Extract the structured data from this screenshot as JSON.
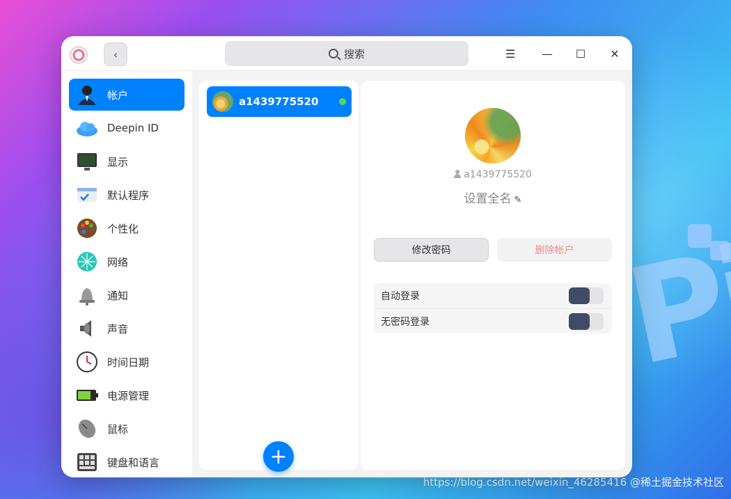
{
  "window": {
    "search_placeholder": "搜索",
    "back_label": "‹",
    "menu_label": "☰",
    "minimize_label": "—",
    "maximize_label": "☐",
    "close_label": "✕"
  },
  "sidebar": {
    "items": [
      {
        "label": "帐户",
        "icon": "account-icon",
        "active": true
      },
      {
        "label": "Deepin ID",
        "icon": "cloud-icon"
      },
      {
        "label": "显示",
        "icon": "display-icon"
      },
      {
        "label": "默认程序",
        "icon": "default-apps-icon"
      },
      {
        "label": "个性化",
        "icon": "palette-icon"
      },
      {
        "label": "网络",
        "icon": "network-icon"
      },
      {
        "label": "通知",
        "icon": "bell-icon"
      },
      {
        "label": "声音",
        "icon": "speaker-icon"
      },
      {
        "label": "时间日期",
        "icon": "clock-icon"
      },
      {
        "label": "电源管理",
        "icon": "battery-icon"
      },
      {
        "label": "鼠标",
        "icon": "mouse-icon"
      },
      {
        "label": "键盘和语言",
        "icon": "keyboard-icon"
      }
    ]
  },
  "users": {
    "items": [
      {
        "name": "a1439775520",
        "online": true
      }
    ],
    "add_label": "+"
  },
  "detail": {
    "username": "a1439775520",
    "fullname_label": "设置全名",
    "change_password_label": "修改密码",
    "delete_account_label": "删除帐户",
    "options": [
      {
        "label": "自动登录",
        "enabled": false
      },
      {
        "label": "无密码登录",
        "enabled": false
      }
    ]
  },
  "watermark": "https://blog.csdn.net/weixin_46285416  @稀土掘金技术社区",
  "colors": {
    "accent": "#0081ff",
    "online": "#5ed15a",
    "switch_knob": "#414b67",
    "danger_text": "#f28a86"
  }
}
